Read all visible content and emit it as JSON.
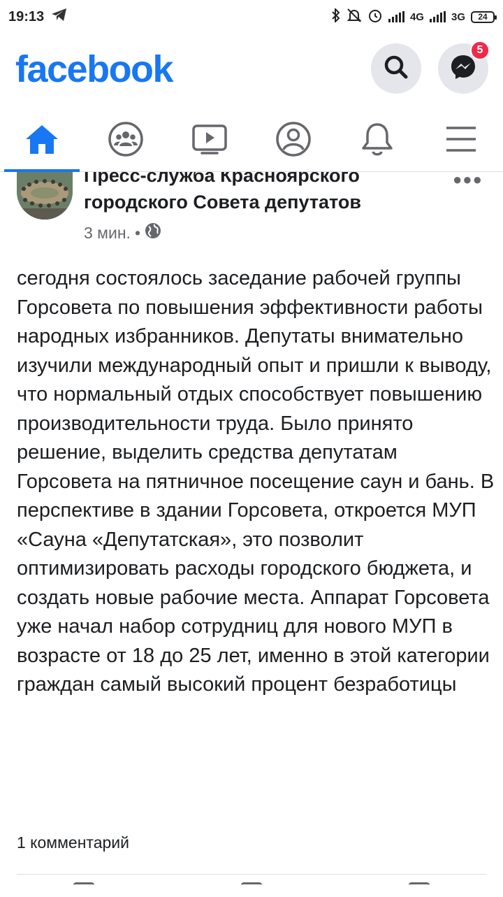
{
  "status_bar": {
    "time": "19:13",
    "network_1": "4G",
    "network_2": "3G",
    "battery": "24",
    "icons": [
      "telegram-icon",
      "bluetooth-icon",
      "mute-icon",
      "alarm-icon",
      "signal-icon",
      "battery-icon"
    ]
  },
  "header": {
    "logo": "facebook",
    "search_icon": "search-icon",
    "messenger_icon": "messenger-icon",
    "messenger_badge": "5",
    "brand_color": "#1877f2",
    "badge_color": "#f02849"
  },
  "nav": {
    "items": [
      {
        "name": "home",
        "icon": "home-icon",
        "active": true
      },
      {
        "name": "groups",
        "icon": "groups-icon",
        "active": false
      },
      {
        "name": "watch",
        "icon": "video-icon",
        "active": false
      },
      {
        "name": "profile",
        "icon": "profile-icon",
        "active": false
      },
      {
        "name": "notifications",
        "icon": "bell-icon",
        "active": false
      },
      {
        "name": "menu",
        "icon": "menu-icon",
        "active": false
      }
    ]
  },
  "post": {
    "author": "Пресс-служба Красноярского городского Совета депутатов",
    "time": "3 мин.",
    "separator": "•",
    "privacy_icon": "globe-icon",
    "text": "сегодня состоялось заседание рабочей группы Горсовета по повышения эффективности работы народных избранников. Депутаты внимательно изучили международный опыт и пришли к выводу, что нормальный отдых способствует повышению производительности труда. Было принято решение, выделить средства депутатам Горсовета на пятничное посещение саун и бань. В перспективе в здании Горсовета, откроется МУП «Сауна «Депутатская», это позволит оптимизировать расходы городского бюджета, и создать новые рабочие места. Аппарат Горсовета уже начал набор сотрудниц для нового МУП в возрасте от 18 до 25 лет, именно в этой категории граждан самый высокий процент безработицы",
    "comments": "1 комментарий"
  }
}
